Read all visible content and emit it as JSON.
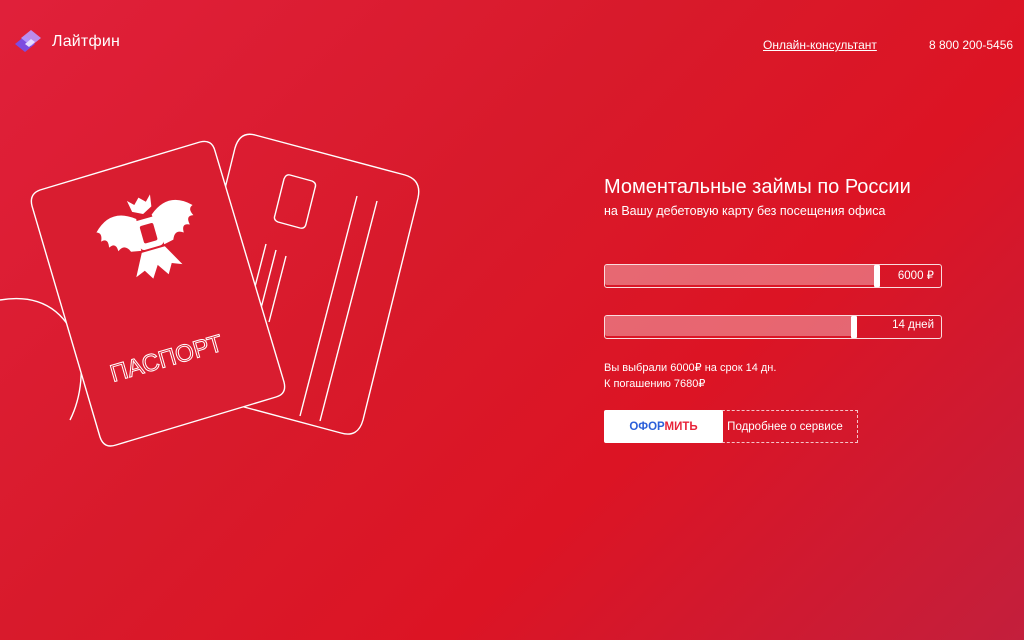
{
  "header": {
    "brand": "Лайтфин",
    "consultant_link": "Онлайн-консультант",
    "phone": "8 800 200-5456"
  },
  "illustration": {
    "passport_label": "ПАСПОРТ"
  },
  "hero": {
    "title": "Моментальные займы по России",
    "subtitle": "на Вашу дебетовую карту без посещения офиса"
  },
  "amount_slider": {
    "value_label": "6000 ₽",
    "fill_fraction": 0.8
  },
  "term_slider": {
    "value_label": "14 дней",
    "fill_fraction": 0.73
  },
  "summary": {
    "line1": "Вы выбрали 6000₽ на срок 14 дн.",
    "line2": "К погашению 7680₽"
  },
  "buttons": {
    "apply_part1": "ОФОР",
    "apply_part2": "МИТЬ",
    "more": "Подробнее о сервисе"
  },
  "colors": {
    "background": "#dc1a2c",
    "apply_text_blue": "#2b5fd9",
    "apply_text_red": "#e8243a"
  }
}
